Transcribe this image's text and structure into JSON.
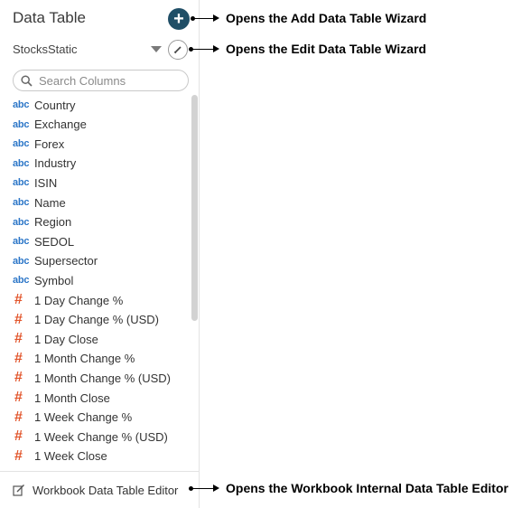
{
  "panel": {
    "title": "Data Table",
    "add_button_icon": "plus-icon",
    "table_name": "StocksStatic",
    "edit_button_icon": "pencil-icon",
    "search_placeholder": "Search Columns",
    "search_value": ""
  },
  "columns": [
    {
      "type": "abc",
      "label": "Country"
    },
    {
      "type": "abc",
      "label": "Exchange"
    },
    {
      "type": "abc",
      "label": "Forex"
    },
    {
      "type": "abc",
      "label": "Industry"
    },
    {
      "type": "abc",
      "label": "ISIN"
    },
    {
      "type": "abc",
      "label": "Name"
    },
    {
      "type": "abc",
      "label": "Region"
    },
    {
      "type": "abc",
      "label": "SEDOL"
    },
    {
      "type": "abc",
      "label": "Supersector"
    },
    {
      "type": "abc",
      "label": "Symbol"
    },
    {
      "type": "#",
      "label": "1 Day Change %"
    },
    {
      "type": "#",
      "label": "1 Day Change % (USD)"
    },
    {
      "type": "#",
      "label": "1 Day Close"
    },
    {
      "type": "#",
      "label": "1 Month Change %"
    },
    {
      "type": "#",
      "label": "1 Month Change % (USD)"
    },
    {
      "type": "#",
      "label": "1 Month Close"
    },
    {
      "type": "#",
      "label": "1 Week Change %"
    },
    {
      "type": "#",
      "label": "1 Week Change % (USD)"
    },
    {
      "type": "#",
      "label": "1 Week Close"
    }
  ],
  "footer": {
    "icon": "edit-box-icon",
    "label": "Workbook Data Table Editor"
  },
  "callouts": {
    "add": "Opens the Add Data Table Wizard",
    "edit": "Opens the Edit Data Table Wizard",
    "workbook": "Opens the Workbook Internal Data Table Editor"
  },
  "colors": {
    "add_button": "#1f4e66",
    "text_type": "#2d77c8",
    "numeric_type": "#e2552b"
  }
}
